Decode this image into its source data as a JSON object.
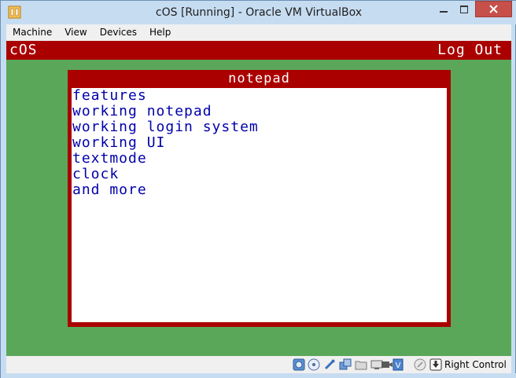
{
  "window": {
    "title": "cOS [Running] - Oracle VM VirtualBox",
    "accent": "#c6dcf1",
    "close_color": "#c7504a"
  },
  "menu": {
    "items": [
      "Machine",
      "View",
      "Devices",
      "Help"
    ]
  },
  "guest": {
    "background": "#5aa75a",
    "bar_color": "#aa0000",
    "os_name": "cOS",
    "logout_label": "Log Out",
    "notepad": {
      "title": "notepad",
      "lines": [
        "features",
        "working notepad",
        "working login system",
        "working UI",
        "textmode",
        "clock",
        "and more"
      ],
      "text_color": "#0000aa"
    }
  },
  "statusbar": {
    "icons": [
      "hard-disk-icon",
      "optical-drive-icon",
      "usb-icon",
      "shared-folders-icon",
      "folder-icon",
      "display-icon",
      "video-capture-icon",
      "network-icon",
      "mouse-integration-icon"
    ],
    "host_key_label": "Right Control"
  }
}
